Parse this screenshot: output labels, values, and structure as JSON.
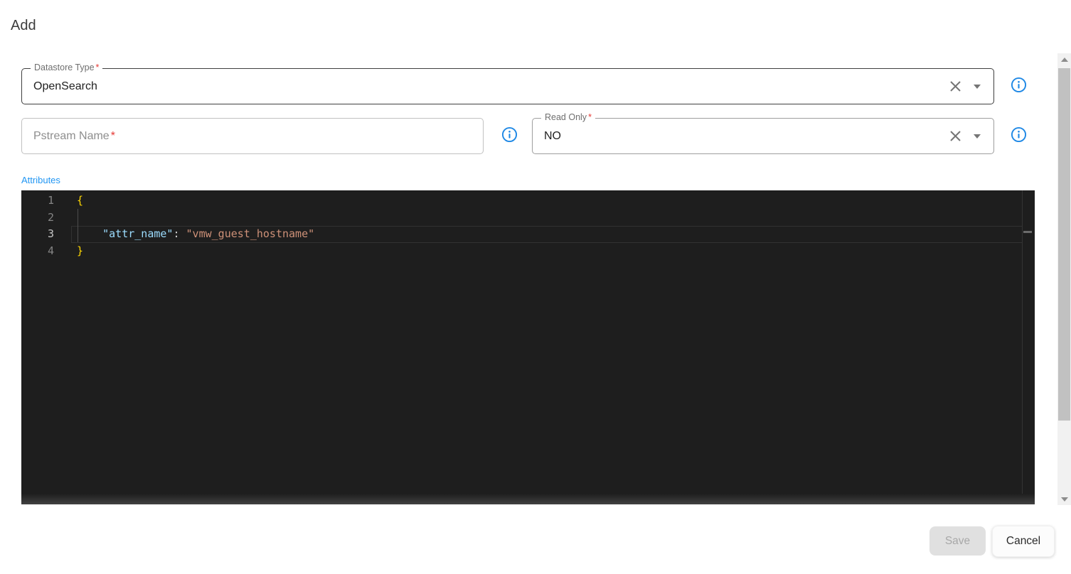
{
  "page": {
    "title": "Add"
  },
  "form": {
    "datastore_type": {
      "label": "Datastore Type",
      "required_marker": "*",
      "value": "OpenSearch"
    },
    "pstream_name": {
      "placeholder": "Pstream Name",
      "required_marker": "*",
      "value": ""
    },
    "read_only": {
      "label": "Read Only",
      "required_marker": "*",
      "value": "NO"
    },
    "attributes_label": "Attributes"
  },
  "editor": {
    "language": "json",
    "active_line": 3,
    "lines": [
      {
        "number": "1",
        "active": false,
        "segments": [
          {
            "type": "bracket",
            "text": "{"
          }
        ]
      },
      {
        "number": "2",
        "active": false,
        "segments": []
      },
      {
        "number": "3",
        "active": true,
        "segments": [
          {
            "type": "plain",
            "text": "    "
          },
          {
            "type": "key",
            "text": "\"attr_name\""
          },
          {
            "type": "plain",
            "text": ": "
          },
          {
            "type": "string",
            "text": "\"vmw_guest_hostname\""
          }
        ]
      },
      {
        "number": "4",
        "active": false,
        "segments": [
          {
            "type": "bracket",
            "text": "}"
          }
        ]
      }
    ]
  },
  "actions": {
    "save_label": "Save",
    "cancel_label": "Cancel"
  },
  "icons": {
    "clear": "clear-x-icon",
    "dropdown": "caret-down-icon",
    "info": "info-icon",
    "scroll_up": "scroll-up-arrow-icon",
    "scroll_down": "scroll-down-arrow-icon"
  },
  "colors": {
    "accent_blue": "#2196f3",
    "info_icon_blue": "#1e88e5",
    "required_red": "#e53935",
    "editor_bg": "#1e1e1e",
    "token_key": "#9cdcfe",
    "token_string": "#ce9178",
    "token_bracket": "#ffd700",
    "line_number": "#858585",
    "active_line_number": "#c6c6c6"
  }
}
